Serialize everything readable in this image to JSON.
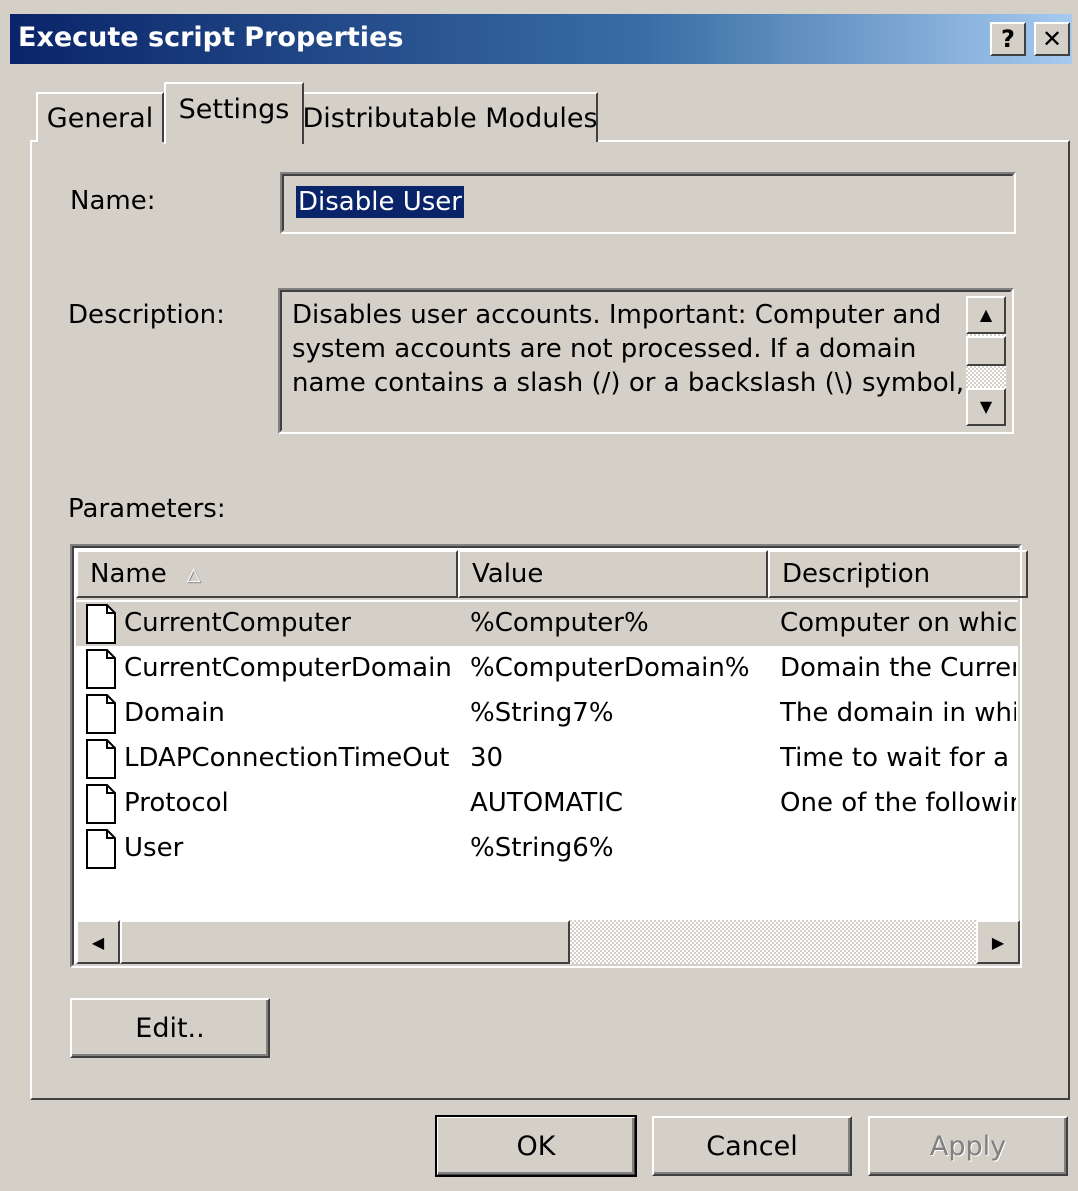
{
  "window": {
    "title": "Execute script Properties",
    "help_label": "?",
    "close_label": "✕"
  },
  "tabs": [
    {
      "label": "General"
    },
    {
      "label": "Settings"
    },
    {
      "label": "Distributable Modules"
    }
  ],
  "form": {
    "name_label": "Name:",
    "name_value": "Disable User",
    "description_label": "Description:",
    "description_lines": [
      "Disables user accounts. Important: Computer and",
      "system accounts are not processed. If a domain",
      "name contains a slash (/) or a backslash (\\) symbol,"
    ],
    "parameters_label": "Parameters:"
  },
  "parameters": {
    "columns": [
      "Name",
      "Value",
      "Description"
    ],
    "rows": [
      {
        "name": "CurrentComputer",
        "value": "%Computer%",
        "description": "Computer on which"
      },
      {
        "name": "CurrentComputerDomain",
        "value": "%ComputerDomain%",
        "description": "Domain the Current"
      },
      {
        "name": "Domain",
        "value": "%String7%",
        "description": "The domain in which"
      },
      {
        "name": "LDAPConnectionTimeOut",
        "value": "30",
        "description": "Time to wait for a s"
      },
      {
        "name": "Protocol",
        "value": "AUTOMATIC",
        "description": "One of the following"
      },
      {
        "name": "User",
        "value": "%String6%",
        "description": ""
      }
    ]
  },
  "buttons": {
    "edit": "Edit..",
    "ok": "OK",
    "cancel": "Cancel",
    "apply": "Apply"
  },
  "icons": {
    "row_icon": "document-icon",
    "sort_icon": "sort-ascending-icon"
  },
  "colors": {
    "title_bar_start": "#0a246a",
    "title_bar_end": "#a6caf0",
    "dialog_face": "#d4d0c8",
    "selection": "#0a246a"
  }
}
